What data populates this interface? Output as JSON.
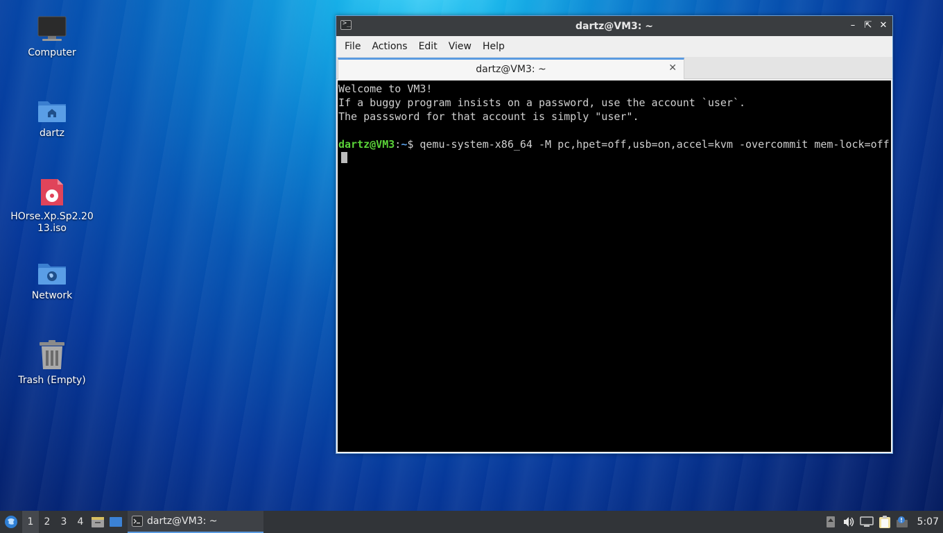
{
  "desktop": {
    "icons": [
      {
        "label": "Computer",
        "icon": "computer-icon"
      },
      {
        "label": "dartz",
        "icon": "home-folder-icon"
      },
      {
        "label": "HOrse.Xp.Sp2.2013.iso",
        "icon": "disc-image-icon"
      },
      {
        "label": "Network",
        "icon": "network-folder-icon"
      },
      {
        "label": "Trash (Empty)",
        "icon": "trash-icon"
      }
    ]
  },
  "window": {
    "title": "dartz@VM3: ~",
    "menu": [
      "File",
      "Actions",
      "Edit",
      "View",
      "Help"
    ],
    "tab_label": "dartz@VM3: ~",
    "terminal": {
      "line1": "Welcome to VM3!",
      "line2": "If a buggy program insists on a password, use the account `user`.",
      "line3": "The passsword for that account is simply \"user\".",
      "prompt_user": "dartz@VM3",
      "prompt_sep": ":",
      "prompt_path": "~",
      "prompt_symbol": "$",
      "command": " qemu-system-x86_64 -M pc,hpet=off,usb=on,accel=kvm -overcommit mem-lock=off"
    }
  },
  "taskbar": {
    "workspaces": [
      "1",
      "2",
      "3",
      "4"
    ],
    "active_workspace": "1",
    "task_label": "dartz@VM3: ~",
    "clock": "5:07",
    "accent": "#5a9ae0"
  }
}
